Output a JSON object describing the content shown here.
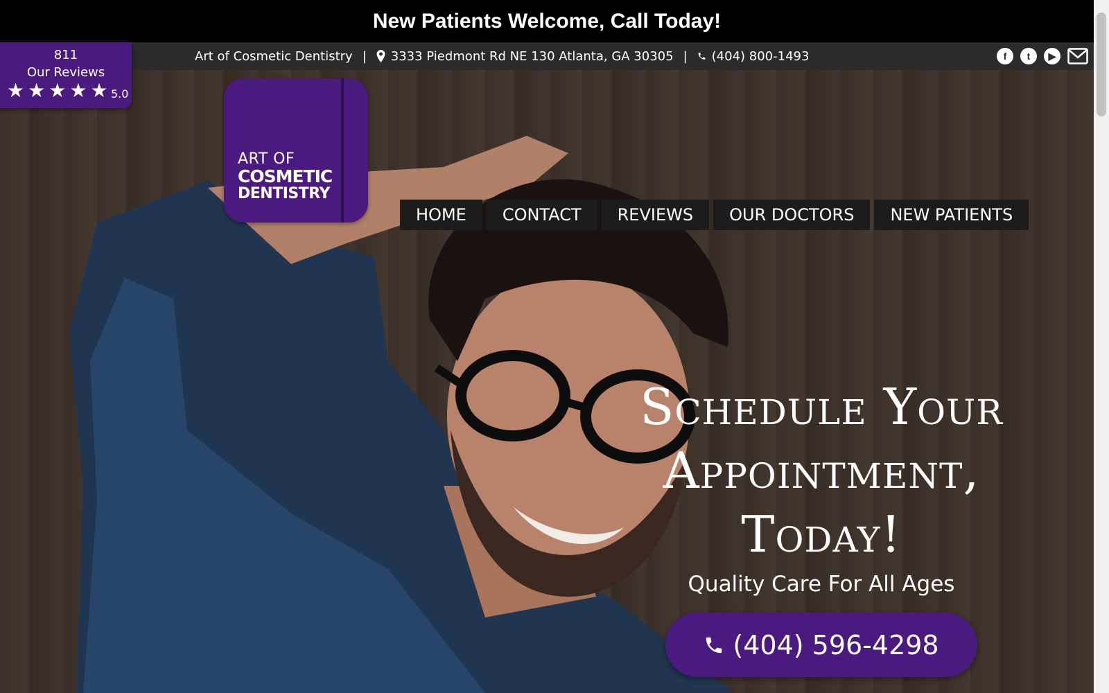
{
  "announcement": "New Patients Welcome, Call Today!",
  "info_bar": {
    "practice_name": "Art of Cosmetic Dentistry",
    "separator": "|",
    "address": "3333 Piedmont Rd NE 130  Atlanta,  GA  30305",
    "phone": "(404) 800-1493",
    "social": [
      {
        "icon": "facebook-icon",
        "glyph": "f"
      },
      {
        "icon": "twitter-icon",
        "glyph": "t"
      },
      {
        "icon": "youtube-icon",
        "glyph": "▶"
      },
      {
        "icon": "email-icon",
        "glyph": "✉"
      }
    ]
  },
  "reviews_badge": {
    "count": "811",
    "label": "Our Reviews",
    "rating": 5,
    "score": "5.0"
  },
  "logo": {
    "line1": "ART OF",
    "line2": "COSMETIC",
    "line3": "DENTISTRY"
  },
  "nav": [
    "HOME",
    "CONTACT",
    "REVIEWS",
    "OUR DOCTORS",
    "NEW PATIENTS"
  ],
  "hero": {
    "headline_1": "Schedule Your",
    "headline_2": "Appointment,",
    "headline_3": "Today!",
    "subheadline": "Quality Care For All Ages",
    "cta_phone": "(404) 596-4298"
  },
  "colors": {
    "brand_purple": "#4b1a7e",
    "top_bar": "#000000",
    "info_bar": "#2b2b2b",
    "nav_bg": "#1c1c1c"
  }
}
